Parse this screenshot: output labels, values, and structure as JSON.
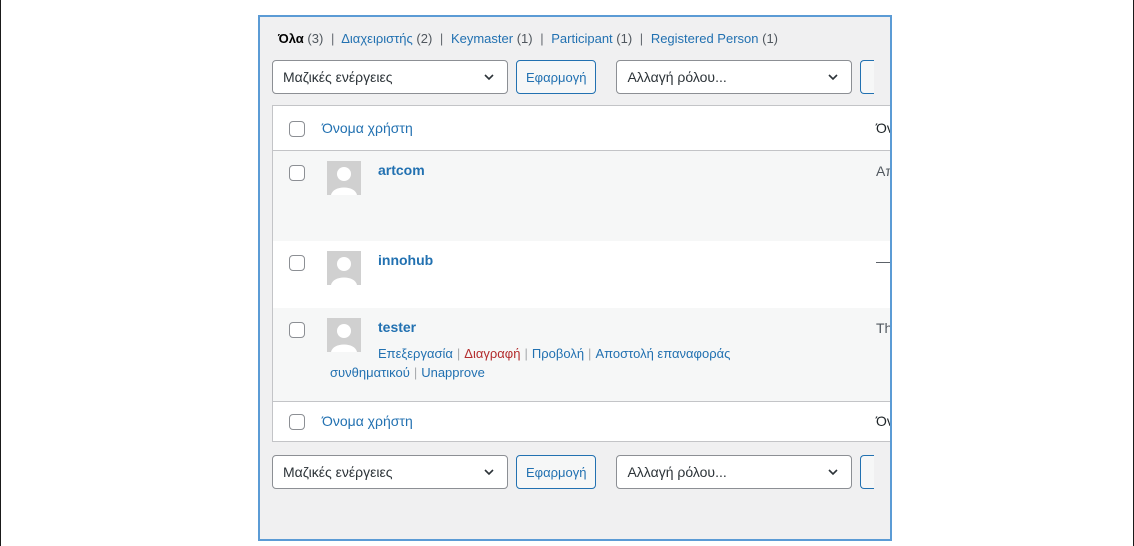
{
  "filters": {
    "all_label": "Όλα",
    "all_count": "(3)",
    "items": [
      {
        "label": "Διαχειριστής",
        "count": "(2)"
      },
      {
        "label": "Keymaster",
        "count": "(1)"
      },
      {
        "label": "Participant",
        "count": "(1)"
      },
      {
        "label": "Registered Person",
        "count": "(1)"
      }
    ],
    "separator": "|"
  },
  "bulk_actions": {
    "selected": "Μαζικές ενέργειες",
    "apply_label": "Εφαρμογή"
  },
  "change_role": {
    "selected": "Αλλαγή ρόλου..."
  },
  "table": {
    "columns": [
      "Όνομα χρήστη",
      "Όν"
    ],
    "rows": [
      {
        "username": "artcom",
        "second_col": "Απ"
      },
      {
        "username": "innohub",
        "second_col": "—"
      },
      {
        "username": "tester",
        "second_col": "Th"
      }
    ],
    "row_actions": {
      "edit": "Επεξεργασία",
      "delete": "Διαγραφή",
      "view": "Προβολή",
      "reset_password_line1": "Αποστολή επαναφοράς",
      "reset_password_line2": "συνθηματικού",
      "unapprove": "Unapprove",
      "separator": "|"
    }
  },
  "colors": {
    "link": "#2271b1",
    "delete": "#b32d2e",
    "panel_border": "#5b9bd5",
    "panel_bg": "#f0f0f1"
  },
  "icons": [
    "chevron-down-icon",
    "avatar-placeholder-icon"
  ]
}
